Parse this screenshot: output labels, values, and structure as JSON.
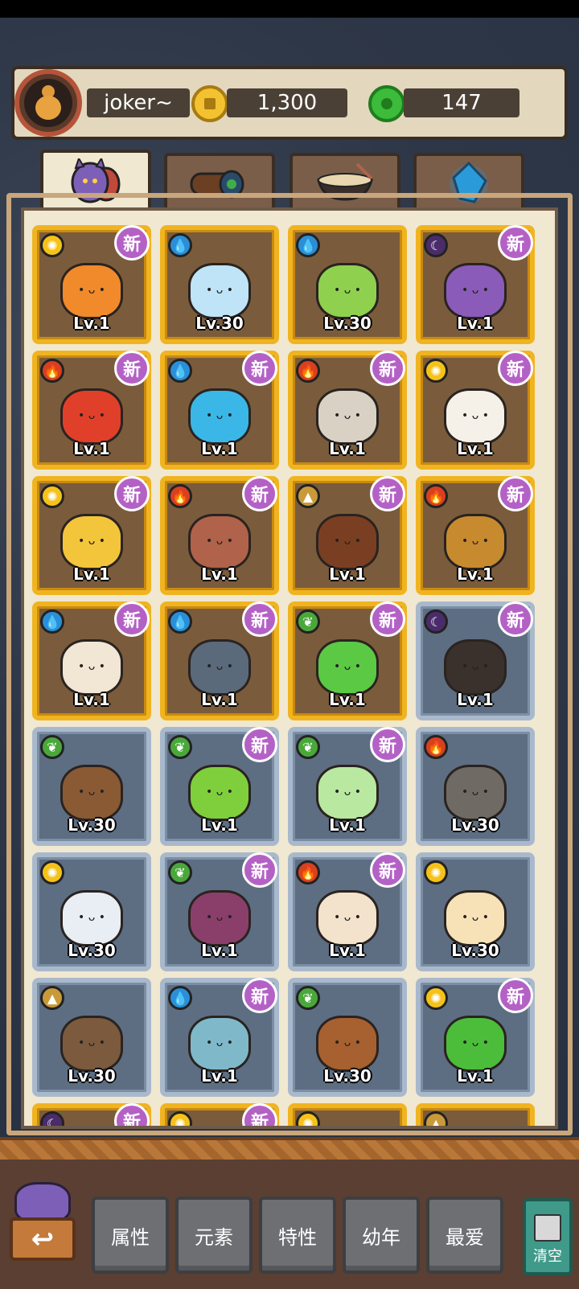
{
  "header": {
    "username": "joker~",
    "gold": "1,300",
    "jade": "147"
  },
  "tabs": [
    {
      "name": "monsters",
      "active": true
    },
    {
      "name": "items",
      "active": false
    },
    {
      "name": "food",
      "active": false
    },
    {
      "name": "crystals",
      "active": false
    }
  ],
  "cards": [
    {
      "elem": "light",
      "lvl": "Lv.1",
      "new": true,
      "frame": "gold",
      "color": "#f08a2a"
    },
    {
      "elem": "water",
      "lvl": "Lv.30",
      "new": false,
      "frame": "gold",
      "color": "#bfe4f7"
    },
    {
      "elem": "water",
      "lvl": "Lv.30",
      "new": false,
      "frame": "gold",
      "color": "#8fd14f"
    },
    {
      "elem": "dark",
      "lvl": "Lv.1",
      "new": true,
      "frame": "gold",
      "color": "#8a5bb8"
    },
    {
      "elem": "fire",
      "lvl": "Lv.1",
      "new": true,
      "frame": "gold",
      "color": "#e0402a"
    },
    {
      "elem": "water",
      "lvl": "Lv.1",
      "new": true,
      "frame": "gold",
      "color": "#3ab7e6"
    },
    {
      "elem": "fire",
      "lvl": "Lv.1",
      "new": true,
      "frame": "gold",
      "color": "#d9d2c4"
    },
    {
      "elem": "light",
      "lvl": "Lv.1",
      "new": true,
      "frame": "gold",
      "color": "#f6f1e8"
    },
    {
      "elem": "light",
      "lvl": "Lv.1",
      "new": true,
      "frame": "gold",
      "color": "#f3c53a"
    },
    {
      "elem": "fire",
      "lvl": "Lv.1",
      "new": true,
      "frame": "gold",
      "color": "#b0624a"
    },
    {
      "elem": "earth",
      "lvl": "Lv.1",
      "new": true,
      "frame": "gold",
      "color": "#7a3f22"
    },
    {
      "elem": "fire",
      "lvl": "Lv.1",
      "new": true,
      "frame": "gold",
      "color": "#c78a2e"
    },
    {
      "elem": "water",
      "lvl": "Lv.1",
      "new": true,
      "frame": "gold",
      "color": "#f2e6d4"
    },
    {
      "elem": "water",
      "lvl": "Lv.1",
      "new": true,
      "frame": "gold",
      "color": "#5b6a7a"
    },
    {
      "elem": "leaf",
      "lvl": "Lv.1",
      "new": true,
      "frame": "gold",
      "color": "#5bc944"
    },
    {
      "elem": "dark",
      "lvl": "Lv.1",
      "new": true,
      "frame": "gray",
      "color": "#3a302c"
    },
    {
      "elem": "leaf",
      "lvl": "Lv.30",
      "new": false,
      "frame": "gray",
      "color": "#8a5a34"
    },
    {
      "elem": "leaf",
      "lvl": "Lv.1",
      "new": true,
      "frame": "gray",
      "color": "#7fcf3c"
    },
    {
      "elem": "leaf",
      "lvl": "Lv.1",
      "new": true,
      "frame": "gray",
      "color": "#b9e8a0"
    },
    {
      "elem": "fire",
      "lvl": "Lv.30",
      "new": false,
      "frame": "gray",
      "color": "#6f6a64"
    },
    {
      "elem": "light",
      "lvl": "Lv.30",
      "new": false,
      "frame": "gray",
      "color": "#e9eef4"
    },
    {
      "elem": "leaf",
      "lvl": "Lv.1",
      "new": true,
      "frame": "gray",
      "color": "#8a3f6a"
    },
    {
      "elem": "fire",
      "lvl": "Lv.1",
      "new": true,
      "frame": "gray",
      "color": "#f3e2cc"
    },
    {
      "elem": "light",
      "lvl": "Lv.30",
      "new": false,
      "frame": "gray",
      "color": "#f7e2b8"
    },
    {
      "elem": "earth",
      "lvl": "Lv.30",
      "new": false,
      "frame": "gray",
      "color": "#7b5a3e"
    },
    {
      "elem": "water",
      "lvl": "Lv.1",
      "new": true,
      "frame": "gray",
      "color": "#7fb9c9"
    },
    {
      "elem": "leaf",
      "lvl": "Lv.30",
      "new": false,
      "frame": "gray",
      "color": "#a7602f"
    },
    {
      "elem": "light",
      "lvl": "Lv.1",
      "new": true,
      "frame": "gray",
      "color": "#4cbd3a"
    },
    {
      "elem": "dark",
      "lvl": "",
      "new": true,
      "frame": "gold",
      "color": "#b0624a"
    },
    {
      "elem": "light",
      "lvl": "",
      "new": true,
      "frame": "gold",
      "color": "#b0624a"
    },
    {
      "elem": "light",
      "lvl": "",
      "new": false,
      "frame": "gold",
      "color": "#b0624a"
    },
    {
      "elem": "earth",
      "lvl": "",
      "new": false,
      "frame": "gold",
      "color": "#b0624a"
    }
  ],
  "labels": {
    "new": "新"
  },
  "elements": {
    "light": {
      "icon": "sun-icon",
      "glyph": "✺",
      "color": "#f5c21a"
    },
    "water": {
      "icon": "water-drop-icon",
      "glyph": "💧",
      "color": "#2a8fd8"
    },
    "dark": {
      "icon": "moon-icon",
      "glyph": "☾",
      "color": "#4a2c6a"
    },
    "fire": {
      "icon": "flame-icon",
      "glyph": "🔥",
      "color": "#d8401e"
    },
    "earth": {
      "icon": "mountain-icon",
      "glyph": "▲",
      "color": "#c99a3a"
    },
    "leaf": {
      "icon": "leaf-icon",
      "glyph": "❦",
      "color": "#4aa83a"
    }
  },
  "bottom": {
    "back_glyph": "↩",
    "filters": [
      "属性",
      "元素",
      "特性",
      "幼年",
      "最爱"
    ],
    "clear": "清空"
  }
}
